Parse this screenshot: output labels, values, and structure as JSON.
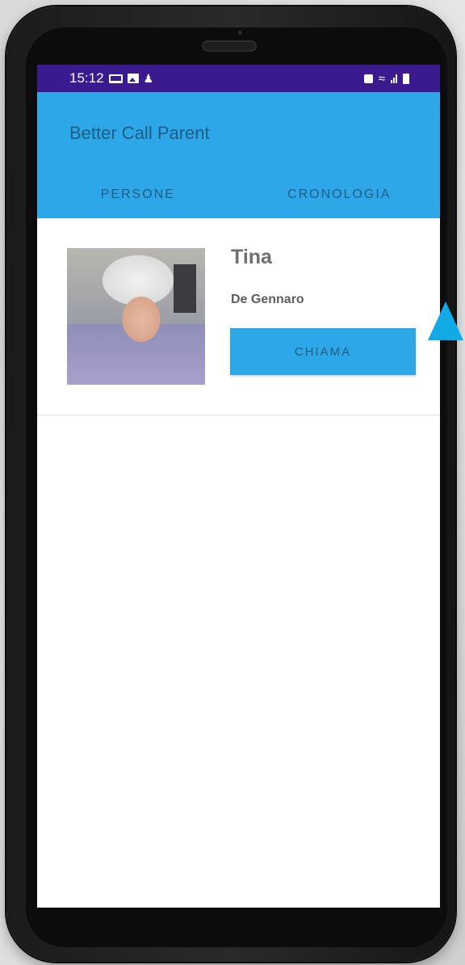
{
  "status_bar": {
    "time": "15:12",
    "left_icons": [
      "laptop-icon",
      "image-icon",
      "person-icon"
    ],
    "right_icons": [
      "lock-icon",
      "wifi-icon",
      "signal-icon",
      "battery-icon"
    ],
    "color": "#3a1a8e"
  },
  "app_bar": {
    "title": "Better Call Parent",
    "color": "#2ea7e8",
    "text_color": "#1e5d86"
  },
  "tabs": [
    {
      "label": "PERSONE"
    },
    {
      "label": "CRONOLOGIA"
    }
  ],
  "contacts": [
    {
      "name": "Tina",
      "surname": "De Gennaro",
      "photo": "elderly-woman-photo",
      "call_label": "CHIAMA"
    }
  ],
  "pointer_arrow": {
    "color": "#12a9e6",
    "icon": "triangle-up-icon"
  }
}
